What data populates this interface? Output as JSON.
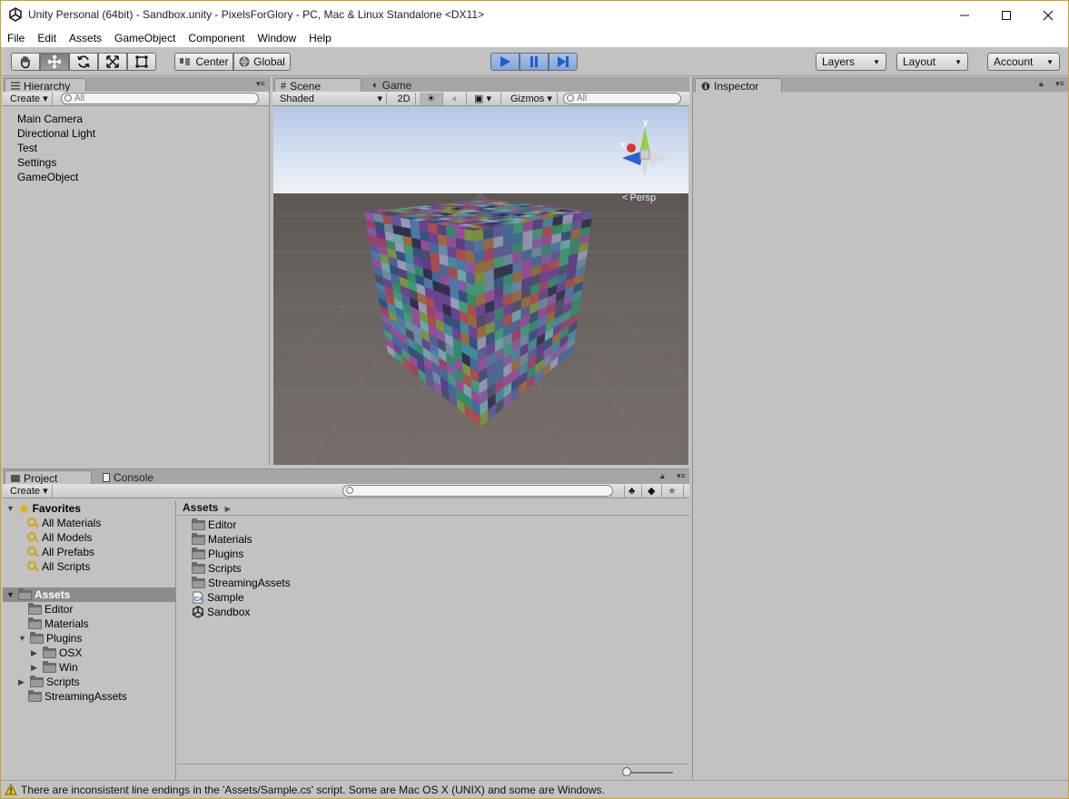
{
  "window": {
    "title": "Unity Personal (64bit) - Sandbox.unity - PixelsForGlory - PC, Mac & Linux Standalone <DX11>"
  },
  "menu": [
    "File",
    "Edit",
    "Assets",
    "GameObject",
    "Component",
    "Window",
    "Help"
  ],
  "toolbar": {
    "pivot_center": "Center",
    "pivot_global": "Global",
    "layers": "Layers",
    "layout": "Layout",
    "account": "Account"
  },
  "hierarchy": {
    "tab": "Hierarchy",
    "create": "Create",
    "search_placeholder": "All",
    "items": [
      "Main Camera",
      "Directional Light",
      "Test",
      "Settings",
      "GameObject"
    ]
  },
  "scene": {
    "tab_scene": "Scene",
    "tab_game": "Game",
    "shading": "Shaded",
    "mode_2d": "2D",
    "gizmos": "Gizmos",
    "search_placeholder": "All",
    "persp": "Persp",
    "axis_y": "y",
    "axis_x": "x"
  },
  "inspector": {
    "tab": "Inspector"
  },
  "project": {
    "tab_project": "Project",
    "tab_console": "Console",
    "create": "Create",
    "favorites_label": "Favorites",
    "favorites": [
      "All Materials",
      "All Models",
      "All Prefabs",
      "All Scripts"
    ],
    "assets_label": "Assets",
    "tree": {
      "editor": "Editor",
      "materials": "Materials",
      "plugins": "Plugins",
      "osx": "OSX",
      "win": "Win",
      "scripts": "Scripts",
      "streaming": "StreamingAssets"
    },
    "breadcrumb": "Assets",
    "contents": [
      {
        "name": "Editor",
        "icon": "folder-icon"
      },
      {
        "name": "Materials",
        "icon": "folder-icon"
      },
      {
        "name": "Plugins",
        "icon": "folder-icon"
      },
      {
        "name": "Scripts",
        "icon": "folder-icon"
      },
      {
        "name": "StreamingAssets",
        "icon": "folder-icon"
      },
      {
        "name": "Sample",
        "icon": "csharp-script-icon"
      },
      {
        "name": "Sandbox",
        "icon": "unity-scene-icon"
      }
    ]
  },
  "status": {
    "message": "There are inconsistent line endings in the 'Assets/Sample.cs' script. Some are Mac OS X (UNIX) and some are Windows."
  },
  "colors": {
    "play_active": "#3f73c7",
    "favorites_icon": "#d5a400",
    "selection": "#8c8c8c"
  }
}
